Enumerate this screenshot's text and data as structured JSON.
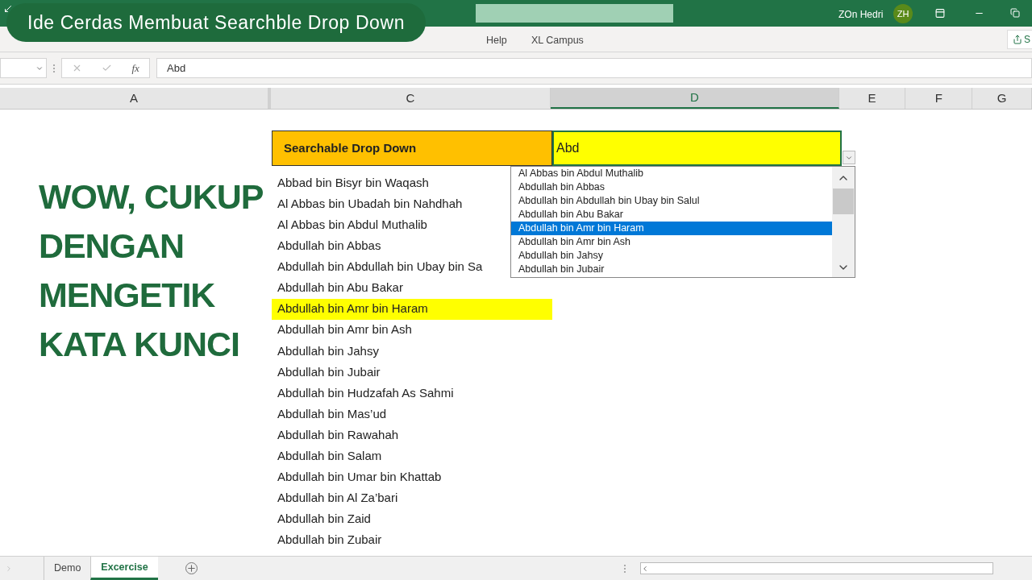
{
  "overlay": {
    "title": "Ide Cerdas Membuat Searchble Drop Down",
    "caption": "WOW, CUKUP\nDENGAN\nMENGETIK\nKATA KUNCI"
  },
  "title_bar": {
    "user": "ZOn Hedri",
    "initials": "ZH"
  },
  "ribbon": {
    "tabs": [
      {
        "label": "Help"
      },
      {
        "label": "XL Campus"
      }
    ],
    "share": "S"
  },
  "formula_bar": {
    "function_label": "fx",
    "value": "Abd"
  },
  "columns": [
    {
      "label": "A",
      "selected": false
    },
    {
      "label": "C",
      "selected": false
    },
    {
      "label": "D",
      "selected": true
    },
    {
      "label": "E",
      "selected": false
    },
    {
      "label": "F",
      "selected": false
    },
    {
      "label": "G",
      "selected": false
    }
  ],
  "header_cell": {
    "label": "Searchable Drop Down",
    "value": "Abd"
  },
  "names": [
    {
      "text": "Abbad bin Bisyr bin Waqash",
      "highlighted": false
    },
    {
      "text": "Al Abbas bin Ubadah bin Nahdhah",
      "highlighted": false
    },
    {
      "text": "Al Abbas bin Abdul Muthalib",
      "highlighted": false
    },
    {
      "text": "Abdullah bin Abbas",
      "highlighted": false
    },
    {
      "text": "Abdullah bin Abdullah bin Ubay bin Sa",
      "highlighted": false
    },
    {
      "text": "Abdullah bin Abu Bakar",
      "highlighted": false
    },
    {
      "text": "Abdullah bin Amr bin Haram",
      "highlighted": true
    },
    {
      "text": "Abdullah bin Amr bin Ash",
      "highlighted": false
    },
    {
      "text": "Abdullah bin Jahsy",
      "highlighted": false
    },
    {
      "text": "Abdullah bin Jubair",
      "highlighted": false
    },
    {
      "text": "Abdullah bin Hudzafah As Sahmi",
      "highlighted": false
    },
    {
      "text": "Abdullah bin Mas’ud",
      "highlighted": false
    },
    {
      "text": "Abdullah bin Rawahah",
      "highlighted": false
    },
    {
      "text": "Abdullah bin Salam",
      "highlighted": false
    },
    {
      "text": "Abdullah bin Umar bin Khattab",
      "highlighted": false
    },
    {
      "text": "Abdullah bin Al Za’bari",
      "highlighted": false
    },
    {
      "text": "Abdullah bin Zaid",
      "highlighted": false
    },
    {
      "text": "Abdullah bin Zubair",
      "highlighted": false
    }
  ],
  "dropdown": {
    "items": [
      {
        "text": "Al Abbas bin Abdul Muthalib",
        "selected": false
      },
      {
        "text": "Abdullah bin Abbas",
        "selected": false
      },
      {
        "text": "Abdullah bin Abdullah bin Ubay bin Salul",
        "selected": false
      },
      {
        "text": "Abdullah bin Abu Bakar",
        "selected": false
      },
      {
        "text": "Abdullah bin Amr bin Haram",
        "selected": true
      },
      {
        "text": "Abdullah bin Amr bin Ash",
        "selected": false
      },
      {
        "text": "Abdullah bin Jahsy",
        "selected": false
      },
      {
        "text": "Abdullah bin Jubair",
        "selected": false
      }
    ]
  },
  "sheet_tabs": [
    {
      "label": "Demo",
      "selected": false
    },
    {
      "label": "Excercise",
      "selected": true
    }
  ]
}
